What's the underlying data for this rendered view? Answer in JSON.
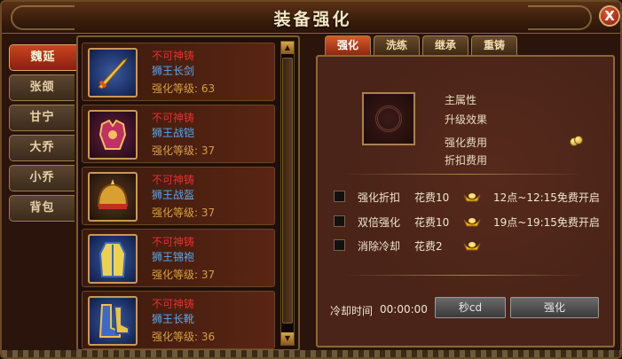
{
  "window": {
    "title": "装备强化",
    "close_label": "X"
  },
  "heroes": [
    {
      "label": "魏延",
      "active": true
    },
    {
      "label": "张颌",
      "active": false
    },
    {
      "label": "甘宁",
      "active": false
    },
    {
      "label": "大乔",
      "active": false
    },
    {
      "label": "小乔",
      "active": false
    },
    {
      "label": "背包",
      "active": false
    }
  ],
  "equipment": [
    {
      "status": "不可神铸",
      "name": "狮王长剑",
      "level_text": "强化等级: 63",
      "level": 63,
      "icon": "sword-icon"
    },
    {
      "status": "不可神铸",
      "name": "狮王战铠",
      "level_text": "强化等级: 37",
      "level": 37,
      "icon": "armor-icon"
    },
    {
      "status": "不可神铸",
      "name": "狮王战盔",
      "level_text": "强化等级: 37",
      "level": 37,
      "icon": "helmet-icon"
    },
    {
      "status": "不可神铸",
      "name": "狮王锦袍",
      "level_text": "强化等级: 37",
      "level": 37,
      "icon": "robe-icon"
    },
    {
      "status": "不可神铸",
      "name": "狮王长靴",
      "level_text": "强化等级: 36",
      "level": 36,
      "icon": "boots-icon"
    }
  ],
  "tabs": [
    {
      "label": "强化",
      "active": true
    },
    {
      "label": "洗练",
      "active": false
    },
    {
      "label": "继承",
      "active": false
    },
    {
      "label": "重铸",
      "active": false
    }
  ],
  "stats": {
    "main_attr": "主属性",
    "upgrade_effect": "升级效果",
    "cost": "强化费用",
    "discount_cost": "折扣费用"
  },
  "options": [
    {
      "name": "强化折扣",
      "cost": "花费10",
      "time": "12点~12:15免费开启"
    },
    {
      "name": "双倍强化",
      "cost": "花费10",
      "time": "19点~19:15免费开启"
    },
    {
      "name": "消除冷却",
      "cost": "花费2",
      "time": ""
    }
  ],
  "cooldown": {
    "label": "冷却时间",
    "time": "00:00:00"
  },
  "buttons": {
    "cd": "秒cd",
    "strengthen": "强化"
  },
  "colors": {
    "status_red": "#e53030",
    "name_blue": "#5aa8f0",
    "level_gold": "#d8a040",
    "active_tab": "#c8441e"
  }
}
